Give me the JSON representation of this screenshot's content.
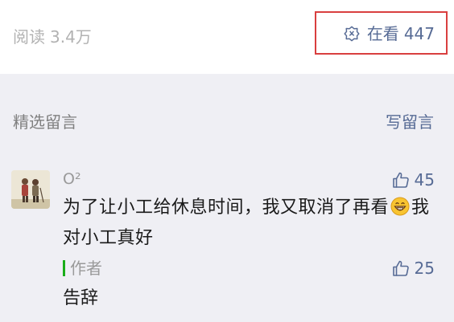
{
  "article_footer": {
    "read_label": "阅读",
    "read_count": "3.4万",
    "wow_label": "在看",
    "wow_count": "447",
    "wow_icon": "wow-flower-icon"
  },
  "comments_section": {
    "title": "精选留言",
    "write_label": "写留言"
  },
  "comment": {
    "nickname": "O²",
    "likes": "45",
    "text_part1": "为了让小工给休息时间，我又取消了再看",
    "text_part2": "我对小工真好",
    "emoji_icon": "grinning-emoji-icon",
    "reply": {
      "author_label": "作者",
      "likes": "25",
      "text": "告辞"
    }
  },
  "colors": {
    "link": "#576b95",
    "highlight_border": "#d93f3f",
    "author_marker": "#1aad19",
    "background": "#efeff4"
  }
}
